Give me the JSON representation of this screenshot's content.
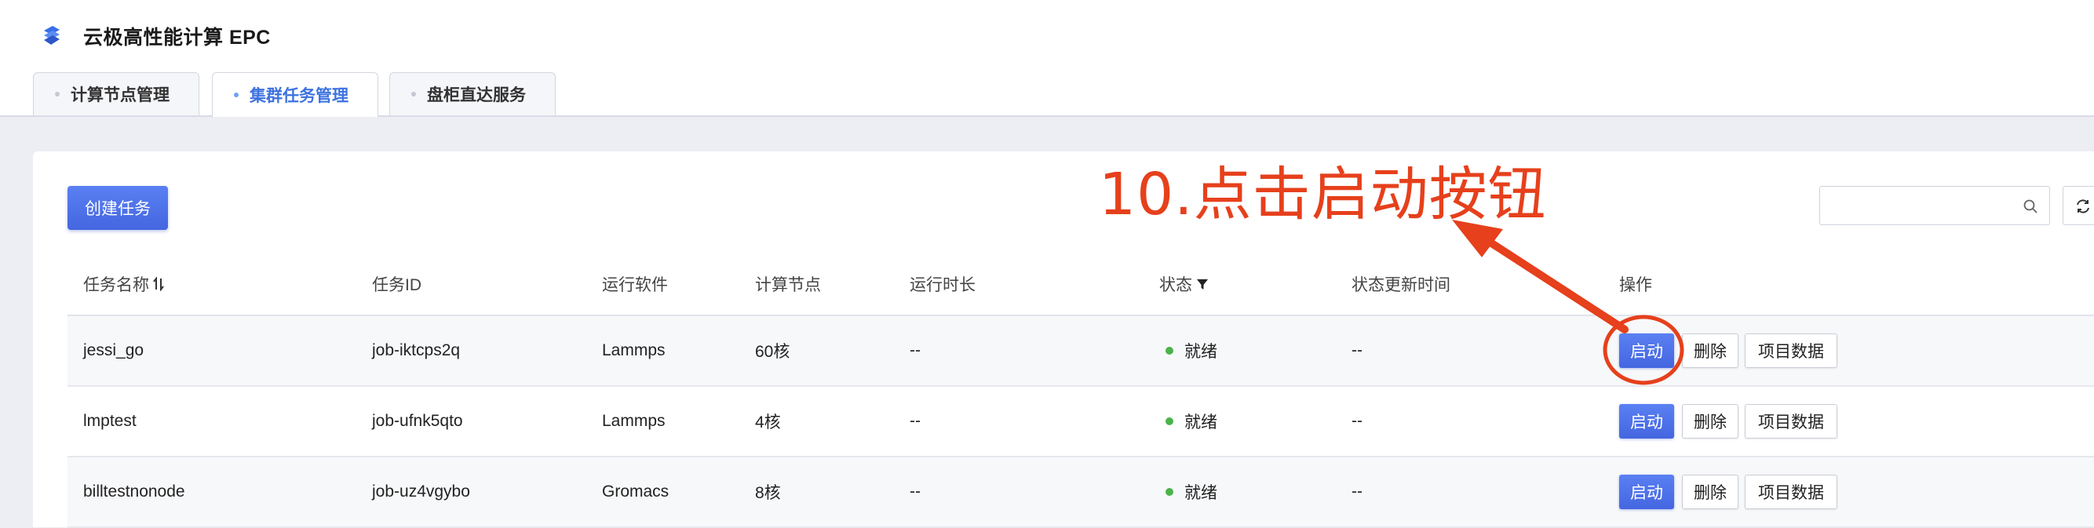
{
  "app": {
    "title": "云极高性能计算 EPC"
  },
  "tabs": [
    {
      "label": "计算节点管理"
    },
    {
      "label": "集群任务管理"
    },
    {
      "label": "盘柜直达服务"
    }
  ],
  "toolbar": {
    "create_label": "创建任务",
    "search_placeholder": ""
  },
  "table": {
    "columns": [
      "任务名称",
      "任务ID",
      "运行软件",
      "计算节点",
      "运行时长",
      "状态",
      "状态更新时间",
      "操作"
    ],
    "rows": [
      {
        "name": "jessi_go",
        "id": "job-iktcps2q",
        "software": "Lammps",
        "nodes": "60核",
        "duration": "--",
        "status": "就绪",
        "updated": "--"
      },
      {
        "name": "lmptest",
        "id": "job-ufnk5qto",
        "software": "Lammps",
        "nodes": "4核",
        "duration": "--",
        "status": "就绪",
        "updated": "--"
      },
      {
        "name": "billtestnonode",
        "id": "job-uz4vgybo",
        "software": "Gromacs",
        "nodes": "8核",
        "duration": "--",
        "status": "就绪",
        "updated": "--"
      }
    ],
    "actions": {
      "start": "启动",
      "delete": "删除",
      "project_data": "项目数据"
    }
  },
  "annotation": {
    "text": "10.点击启动按钮",
    "color": "#e6401c"
  },
  "colors": {
    "accent": "#4a6fe6",
    "status_ready": "#4bb34b",
    "annotation": "#e6401c"
  },
  "icons": [
    "logo-icon",
    "sort-icon",
    "filter-icon",
    "search-icon",
    "refresh-icon"
  ]
}
